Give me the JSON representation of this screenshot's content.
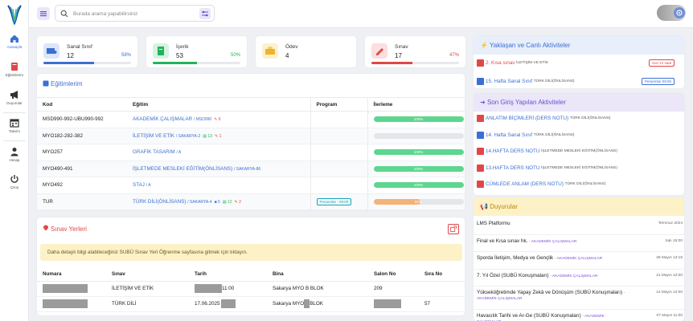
{
  "sidebar": {
    "items": [
      {
        "label": "Anasayfa",
        "icon": "home-icon"
      },
      {
        "label": "Eğitimlerim",
        "icon": "book-icon"
      },
      {
        "label": "Duyurular",
        "icon": "megaphone-icon"
      },
      {
        "label": "Takvim",
        "icon": "calendar-icon"
      },
      {
        "label": "Hesap",
        "icon": "user-icon"
      },
      {
        "label": "Çıkış",
        "icon": "power-icon"
      }
    ]
  },
  "search": {
    "placeholder": "Burada arama yapabilirsiniz"
  },
  "stats": [
    {
      "title": "Sanal Sınıf",
      "value": "12",
      "percent": "58%",
      "fill": 58,
      "color": "#3b6fd4"
    },
    {
      "title": "İçerik",
      "value": "53",
      "percent": "50%",
      "fill": 50,
      "color": "#22b35a"
    },
    {
      "title": "Ödev",
      "value": "4",
      "percent": "",
      "fill": 0,
      "color": "#f0b429"
    },
    {
      "title": "Sınav",
      "value": "17",
      "percent": "47%",
      "fill": 47,
      "color": "#e04848"
    }
  ],
  "courses": {
    "title": "Eğitimlerim",
    "headers": {
      "code": "Kod",
      "course": "Eğitim",
      "program": "Program",
      "progress": "İlerleme"
    },
    "rows": [
      {
        "code": "MSD990-992-UBU990-992",
        "name": "AKADEMİK ÇALIŞMALAR",
        "sub": "/ MSD990",
        "tags": [
          "6"
        ],
        "program": "",
        "progress": "100%",
        "fill": 100,
        "color": "#5dd68f"
      },
      {
        "code": "MYO182-282-382",
        "name": "İLETİŞİM VE ETİK",
        "sub": "/ SAKARYA-2",
        "tags": [
          "13",
          "1"
        ],
        "program": "",
        "progress": "",
        "fill": 0,
        "color": "#5dd68f"
      },
      {
        "code": "MYO257",
        "name": "GRAFİK TASARIM",
        "sub": "/ A",
        "tags": [],
        "program": "",
        "progress": "100%",
        "fill": 100,
        "color": "#5dd68f"
      },
      {
        "code": "MYO490-491",
        "name": "İŞLETMEDE MESLEKİ EĞİTİM(ÖNLİSANS)",
        "sub": "/ SAKARYA-86",
        "tags": [],
        "program": "",
        "progress": "100%",
        "fill": 100,
        "color": "#5dd68f"
      },
      {
        "code": "MYO492",
        "name": "STAJ",
        "sub": "/ A",
        "tags": [],
        "program": "",
        "progress": "100%",
        "fill": 100,
        "color": "#5dd68f"
      },
      {
        "code": "TUR",
        "name": "TÜRK DİLİ(ÖNLİSANS)",
        "sub": "/ SAKARYA-4",
        "tags": [
          "5",
          "12",
          "2"
        ],
        "program": "Perşembe - 09:00",
        "progress": "52%",
        "fill": 52,
        "color": "#f4b37a"
      }
    ]
  },
  "exams": {
    "title": "Sınav Yerleri",
    "notice": "Daha detaylı bilgi alabileceğiniz SUBÜ Sınav Yeri Öğrenme sayfasına gitmek için tıklayın.",
    "headers": {
      "number": "Numara",
      "exam": "Sınav",
      "date": "Tarih",
      "building": "Bina",
      "room": "Salon No",
      "seat": "Sıra No"
    },
    "rows": [
      {
        "exam": "İLETİŞİM VE ETİK",
        "date": "11:00",
        "building": "Sakarya MYO B BLOK",
        "room": "209",
        "seat": ""
      },
      {
        "exam": "TÜRK DİLİ",
        "date": "17.06.2025",
        "building": "Sakarya MYO",
        "building2": "BLOK",
        "room": "",
        "seat": "57"
      }
    ]
  },
  "upcoming": {
    "title": "Yaklaşan ve Canlı Aktiviteler",
    "items": [
      {
        "num": "2.",
        "text": "Kısa sınav",
        "sub": "İLETİŞİM VE ETİK",
        "badge": "Son 12 saat",
        "badgeColor": "#e04848",
        "icon": "exam-icon"
      },
      {
        "num": "15.",
        "text": "Hafta Sanal Sınıf",
        "sub": "TÜRK DİLİ(ÖNLİSANS)",
        "badge": "Perşembe 09:00",
        "badgeColor": "#3b6fd4",
        "icon": "virtual-class-icon"
      }
    ]
  },
  "recent": {
    "title": "Son Giriş Yapılan Aktiviteler",
    "items": [
      {
        "text": "ANLATIM BİÇİMLERİ (DERS NOTU)",
        "sub": "TÜRK DİLİ(ÖNLİSANS)",
        "icon": "pdf-icon"
      },
      {
        "text": "14. Hafta Sanal Sınıf",
        "sub": "TÜRK DİLİ(ÖNLİSANS)",
        "icon": "virtual-class-icon"
      },
      {
        "text": "14.HAFTA DERS NOTU",
        "sub": "İŞLETMEDE MESLEKİ EĞİTİM(ÖNLİSANS)",
        "icon": "pdf-icon"
      },
      {
        "text": "13.HAFTA DERS NOTU",
        "sub": "İŞLETMEDE MESLEKİ EĞİTİM(ÖNLİSANS)",
        "icon": "pdf-icon"
      },
      {
        "text": "CÜMLEDE ANLAM (DERS NOTU)",
        "sub": "TÜRK DİLİ(ÖNLİSANS)",
        "icon": "pdf-icon"
      }
    ]
  },
  "announcements": {
    "title": "Duyurular",
    "items": [
      {
        "text": "LMS Platformu",
        "src": "",
        "date": "Temmuz 2024"
      },
      {
        "text": "Final ve Kısa sınav hk.",
        "src": "- AKADEMİK ÇALIŞMALAR",
        "date": "Salı 15:00"
      },
      {
        "text": "Sporda İletişim, Medya ve Gençlik",
        "src": "- AKADEMİK ÇALIŞMALAR",
        "date": "28 Mayıs 13:15"
      },
      {
        "text": "7. Yıl Özel (SUBÜ Konuşmaları)",
        "src": "- AKADEMİK ÇALIŞMALAR",
        "date": "21 Mayıs 12:00"
      },
      {
        "text": "Yükseköğretimde Yapay Zekâ ve Dönüşüm (SUBÜ Konuşmaları)",
        "src": "- AKADEMİK ÇALIŞMALAR",
        "date": "14 Mayıs 12:00"
      },
      {
        "text": "Havacılık Tarihi ve Ar-Ge (SUBÜ Konuşmaları)",
        "src": "- AKADEMİK ÇALIŞMALAR",
        "date": "07 Mayıs 11:00"
      }
    ]
  }
}
